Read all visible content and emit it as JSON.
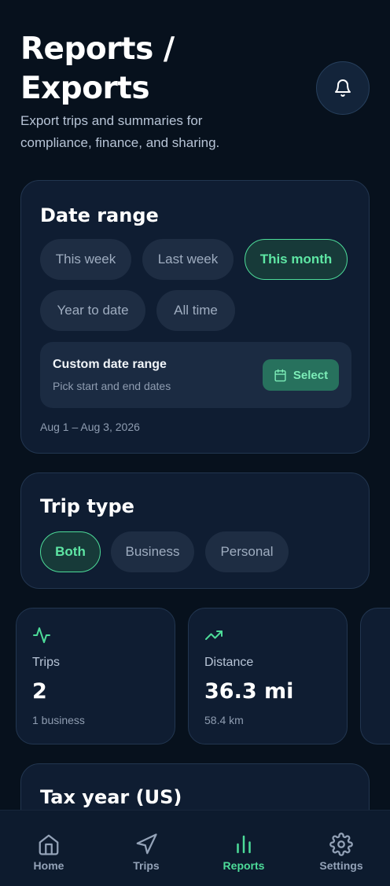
{
  "header": {
    "title": "Reports / Exports",
    "subtitle": "Export trips and summaries for compliance, finance, and sharing."
  },
  "date_range": {
    "title": "Date range",
    "chips": [
      "This week",
      "Last week",
      "This month",
      "Year to date",
      "All time"
    ],
    "selected": "This month",
    "custom": {
      "title": "Custom date range",
      "subtitle": "Pick start and end dates",
      "button_label": "Select"
    },
    "range_text": "Aug 1 – Aug 3, 2026"
  },
  "trip_type": {
    "title": "Trip type",
    "chips": [
      "Both",
      "Business",
      "Personal"
    ],
    "selected": "Both"
  },
  "stats": [
    {
      "icon": "activity-icon",
      "label": "Trips",
      "value": "2",
      "sub": "1 business"
    },
    {
      "icon": "trending-up-icon",
      "label": "Distance",
      "value": "36.3 mi",
      "sub": "58.4 km"
    }
  ],
  "tax_year": {
    "title": "Tax year (US)"
  },
  "tabbar": {
    "tabs": [
      "Home",
      "Trips",
      "Reports",
      "Settings"
    ],
    "active": "Reports"
  },
  "colors": {
    "background": "#07111d",
    "card": "#0f1d32",
    "accent": "#4ddc99"
  }
}
